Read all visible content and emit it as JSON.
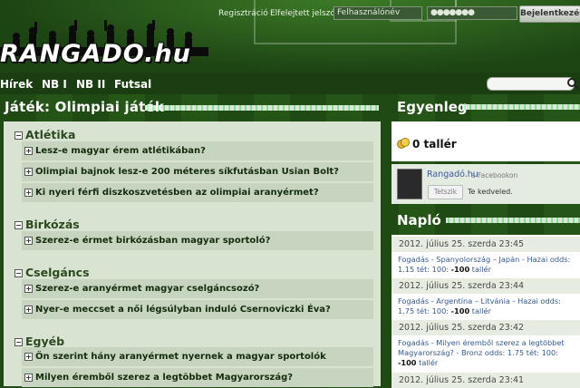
{
  "header": {
    "logo_text": "RANGADO.hu",
    "register_link": "Regisztráció",
    "forgot_password_link": "Elfelejtett jelszó",
    "username_placeholder": "Felhasználónév",
    "password_value": "●●●●●●●",
    "login_button": "Bejelentkezés"
  },
  "nav": {
    "items": [
      "Hírek",
      "NB I",
      "NB II",
      "Futsal"
    ]
  },
  "main": {
    "title": "Játék: Olimpiai játék",
    "categories": [
      {
        "name": "Atlétika",
        "questions": [
          "Lesz-e magyar érem atlétikában?",
          "Olimpiai bajnok lesz-e 200 méteres síkfutásban Usian Bolt?",
          "Ki nyeri férfi diszkoszvetésben az olimpiai aranyérmet?"
        ]
      },
      {
        "name": "Birkózás",
        "questions": [
          "Szerez-e érmet birkózásban magyar sportoló?"
        ]
      },
      {
        "name": "Cselgáncs",
        "questions": [
          "Szerez-e aranyérmet magyar cselgáncsozó?",
          "Nyer-e meccset a női légsúlyban induló Csernoviczki Éva?"
        ]
      },
      {
        "name": "Egyéb",
        "questions": [
          "Ön szerint hány aranyérmet nyernek a magyar sportolók Londonban?",
          "Milyen éremből szerez a legtöbbet Magyarország?"
        ]
      }
    ]
  },
  "right": {
    "balance_title": "Egyenleg",
    "balance_text": "0 tallér",
    "facebook": {
      "name": "Rangadó.hu",
      "suffix": "a Facebookon",
      "like_button": "Tetszik",
      "like_text": "Te kedveled."
    },
    "log_title": "Napló",
    "log_entries": [
      {
        "date": "2012. július 25. szerda 23:45",
        "text": "Fogadás - Spanyolország – Japán - Hazai odds: 1.15 tét: 100:",
        "amount": "-100",
        "unit": "tallér"
      },
      {
        "date": "2012. július 25. szerda 23:44",
        "text": "Fogadás - Argentína – Litvánia - Hazai odds: 1.75 tét: 100:",
        "amount": "-100",
        "unit": "tallér"
      },
      {
        "date": "2012. július 25. szerda 23:42",
        "text": "Fogadás - Milyen éremből szerez a legtöbbet Magyarország? - Bronz odds: 1.75 tét: 100:",
        "amount": "-100",
        "unit": "tallér"
      },
      {
        "date": "2012. július 25. szerda 23:41",
        "text": "",
        "amount": "",
        "unit": ""
      }
    ]
  },
  "colors": {
    "grass_dark": "#1d4413",
    "panel_bg": "#d8e3d2",
    "question_bg": "#c7d4bf",
    "link_blue": "#355a8c"
  }
}
